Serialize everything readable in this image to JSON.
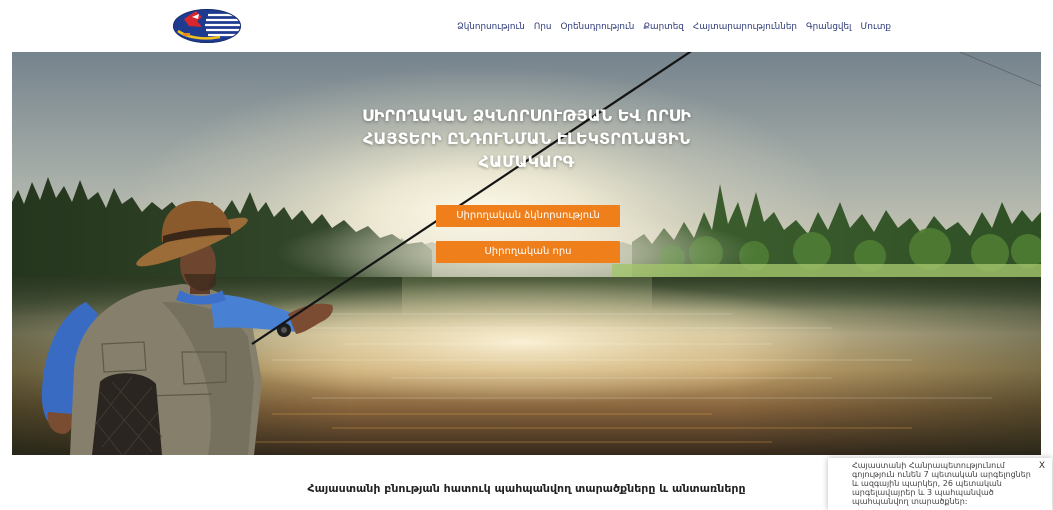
{
  "header": {
    "logo_icon": "hunting-fishing-logo-icon",
    "nav": [
      {
        "label": "Ձկնորսություն"
      },
      {
        "label": "Որս"
      },
      {
        "label": "Օրենսդրություն"
      },
      {
        "label": "Քարտեզ"
      },
      {
        "label": "Հայտարարություններ"
      },
      {
        "label": "Գրանցվել"
      },
      {
        "label": "Մուտք"
      }
    ]
  },
  "hero": {
    "title_lines": [
      "ՍԻՐՈՂԱԿԱՆ ՁԿՆՈՐՍՈՒԹՅԱՆ ԵՎ ՈՐՍԻ",
      "ՀԱՅՏԵՐԻ ԸՆԴՈՒՆՄԱՆ ԷԼԵԿՏՐՈՆԱՅԻՆ",
      "ՀԱՄԱԿԱՐԳ"
    ],
    "buttons": [
      {
        "label": "Սիրողական ձկնորսություն"
      },
      {
        "label": "Սիրողական որս"
      }
    ]
  },
  "section": {
    "heading": "Հայաստանի բնության հատուկ պահպանվող տարածքները և անտառները"
  },
  "popup": {
    "close_label": "X",
    "lines": [
      "Հայաստանի Հանրապետությունում",
      "գոյություն ունեն 7 պետական արգելոցներ",
      "և ազգային պարկեր, 26 պետական",
      "արգելավայրեր և 3 պահպանված",
      "պահպանվող տարածքներ:"
    ]
  },
  "colors": {
    "accent": "#ee7f1b",
    "nav_text": "#2c3a7a",
    "heading_text": "#222222"
  }
}
